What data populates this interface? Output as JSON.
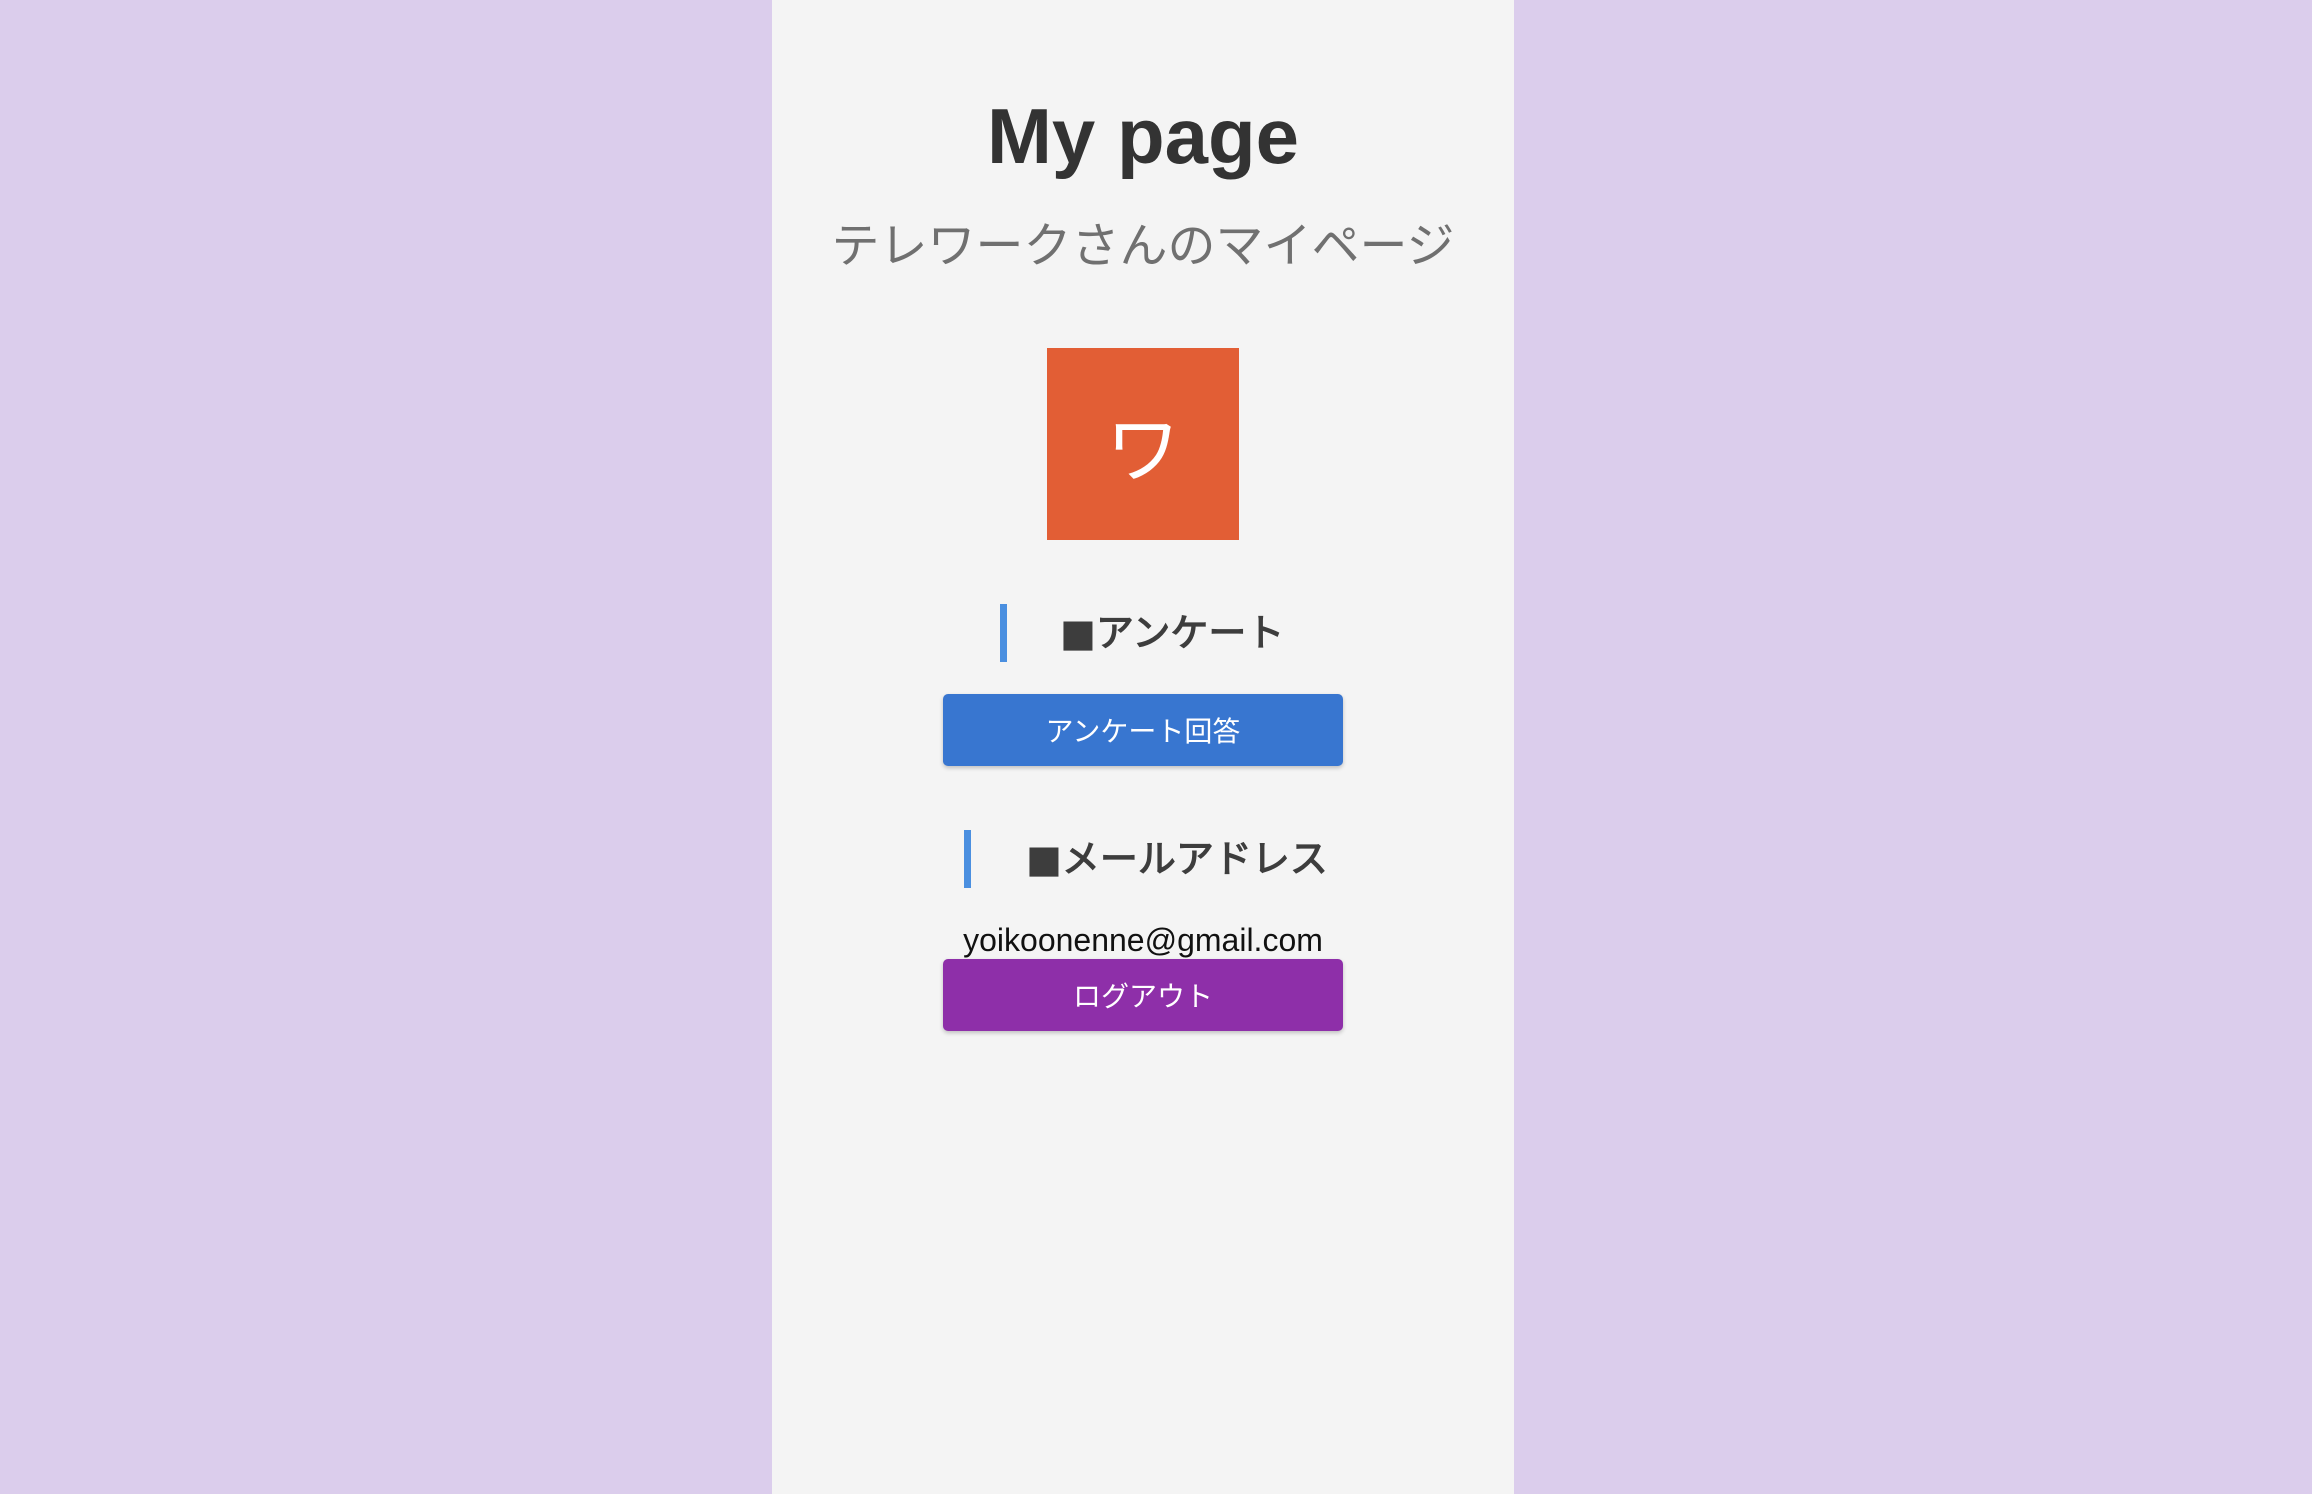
{
  "header": {
    "title": "My page",
    "subtitle": "テレワークさんのマイページ"
  },
  "avatar": {
    "initial": "ワ"
  },
  "survey_section": {
    "heading": "■アンケート",
    "button_label": "アンケート回答"
  },
  "mail_section": {
    "heading": "■メールアドレス",
    "email": "yoikoonenne@gmail.com"
  },
  "logout": {
    "button_label": "ログアウト"
  },
  "colors": {
    "page_background": "#dbcdec",
    "panel_background": "#f4f4f4",
    "avatar_background": "#e25e35",
    "heading_bar": "#4a8fe0",
    "survey_button": "#3876d0",
    "logout_button": "#8e2fa9"
  }
}
